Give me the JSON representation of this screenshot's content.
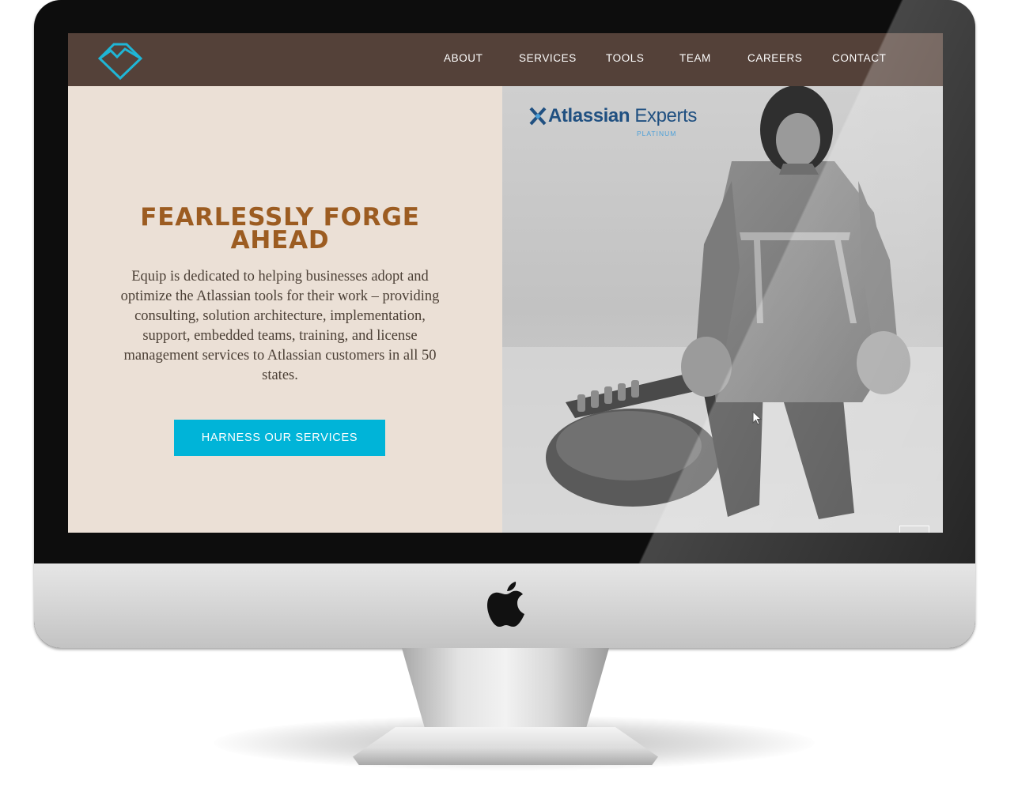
{
  "nav": {
    "items": [
      {
        "label": "ABOUT"
      },
      {
        "label": "SERVICES"
      },
      {
        "label": "TOOLS"
      },
      {
        "label": "TEAM"
      },
      {
        "label": "CAREERS"
      },
      {
        "label": "CONTACT"
      }
    ]
  },
  "hero": {
    "title": "FEARLESSLY FORGE AHEAD",
    "description": "Equip is dedicated to helping businesses adopt and optimize the Atlassian tools for their work – providing consulting, solution architecture, implementation, support, embedded teams, training, and license management services to Atlassian customers in all 50 states.",
    "cta_label": "HARNESS OUR SERVICES"
  },
  "badge": {
    "brand_bold": "Atlassian",
    "brand_light": " Experts",
    "tier": "PLATINUM"
  },
  "colors": {
    "header_bg": "#544139",
    "hero_bg": "#ebe0d6",
    "title": "#9c5c21",
    "accent": "#00b4d8",
    "logo": "#1fb6d6"
  },
  "icons": {
    "logo": "diamond-mountain-logo-icon",
    "device_brand": "apple-logo-icon",
    "badge": "atlassian-x-icon",
    "pointer": "mouse-cursor-icon"
  }
}
